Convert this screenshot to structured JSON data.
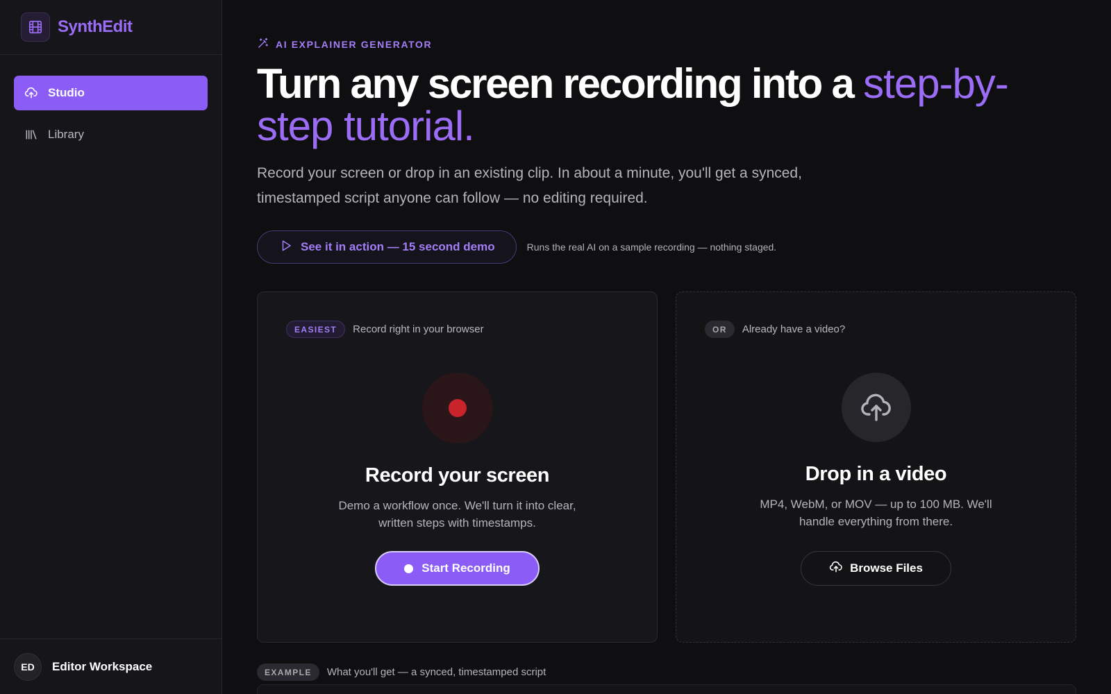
{
  "brand": {
    "name": "SynthEdit",
    "icon": "film-icon"
  },
  "sidebar": {
    "items": [
      {
        "label": "Studio",
        "icon": "cloud-upload-icon",
        "active": true
      },
      {
        "label": "Library",
        "icon": "library-icon",
        "active": false
      }
    ],
    "workspace": {
      "initials": "ED",
      "name": "Editor Workspace"
    }
  },
  "hero": {
    "eyebrow": "AI EXPLAINER GENERATOR",
    "headline_main": "Turn any screen recording into a ",
    "headline_accent": "step-by-step tutorial.",
    "subhead": "Record your screen or drop in an existing clip. In about a minute, you'll get a synced, timestamped script anyone can follow — no editing required.",
    "demo_label": "See it in action — 15 second demo",
    "demo_note": "Runs the real AI on a sample recording — nothing staged."
  },
  "record_card": {
    "tag": "EASIEST",
    "tag_text": "Record right in your browser",
    "title": "Record your screen",
    "desc": "Demo a workflow once. We'll turn it into clear, written steps with timestamps.",
    "button": "Start Recording"
  },
  "upload_card": {
    "tag": "OR",
    "tag_text": "Already have a video?",
    "title": "Drop in a video",
    "desc": "MP4, WebM, or MOV — up to 100 MB. We'll handle everything from there.",
    "button": "Browse Files"
  },
  "example": {
    "tag": "EXAMPLE",
    "text": "What you'll get — a synced, timestamped script"
  },
  "colors": {
    "accent": "#8b5cf6",
    "accent_text": "#9b6cf5",
    "record_red": "#c9242b",
    "background": "#0f0f11",
    "sidebar": "#16161a"
  }
}
